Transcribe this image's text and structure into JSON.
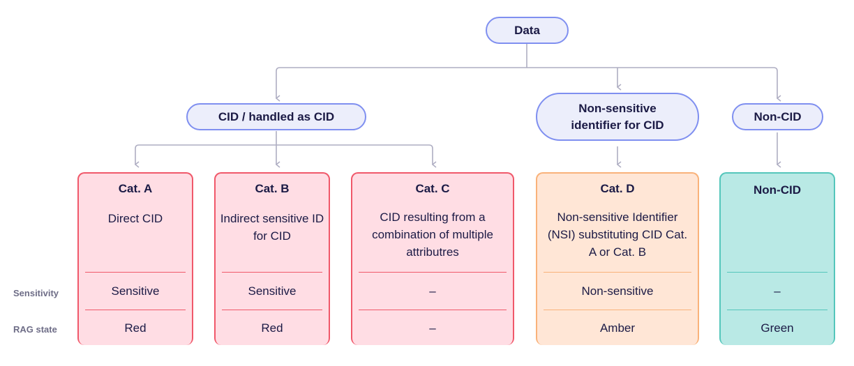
{
  "root": {
    "label": "Data"
  },
  "level1": [
    {
      "id": "cid",
      "label": "CID / handled as CID"
    },
    {
      "id": "nsi",
      "label": "Non-sensitive identifier for CID"
    },
    {
      "id": "noncid",
      "label": "Non-CID"
    }
  ],
  "row_labels": {
    "sensitivity": "Sensitivity",
    "rag": "RAG state"
  },
  "categories": [
    {
      "title": "Cat. A",
      "description": "Direct CID",
      "sensitivity": "Sensitive",
      "rag": "Red",
      "color": "red"
    },
    {
      "title": "Cat. B",
      "description": "Indirect sensitive ID for CID",
      "sensitivity": "Sensitive",
      "rag": "Red",
      "color": "red"
    },
    {
      "title": "Cat. C",
      "description": "CID resulting from a combination of multiple attributres",
      "sensitivity": "–",
      "rag": "–",
      "color": "red"
    },
    {
      "title": "Cat. D",
      "description": "Non-sensitive Identifier (NSI) substituting CID Cat. A or Cat. B",
      "sensitivity": "Non-sensitive",
      "rag": "Amber",
      "color": "amber"
    },
    {
      "title": "Non-CID",
      "description": "",
      "sensitivity": "–",
      "rag": "Green",
      "color": "green"
    }
  ],
  "colors": {
    "pill_border": "#7f8ff0",
    "pill_fill": "#eceefb",
    "red_border": "#f0586a",
    "red_fill": "#ffdde4",
    "amber_border": "#f9b27a",
    "amber_fill": "#ffe6d6",
    "green_border": "#54c6bb",
    "green_fill": "#b9e9e5",
    "connector": "#aeadc2",
    "text": "#1b1a45"
  }
}
